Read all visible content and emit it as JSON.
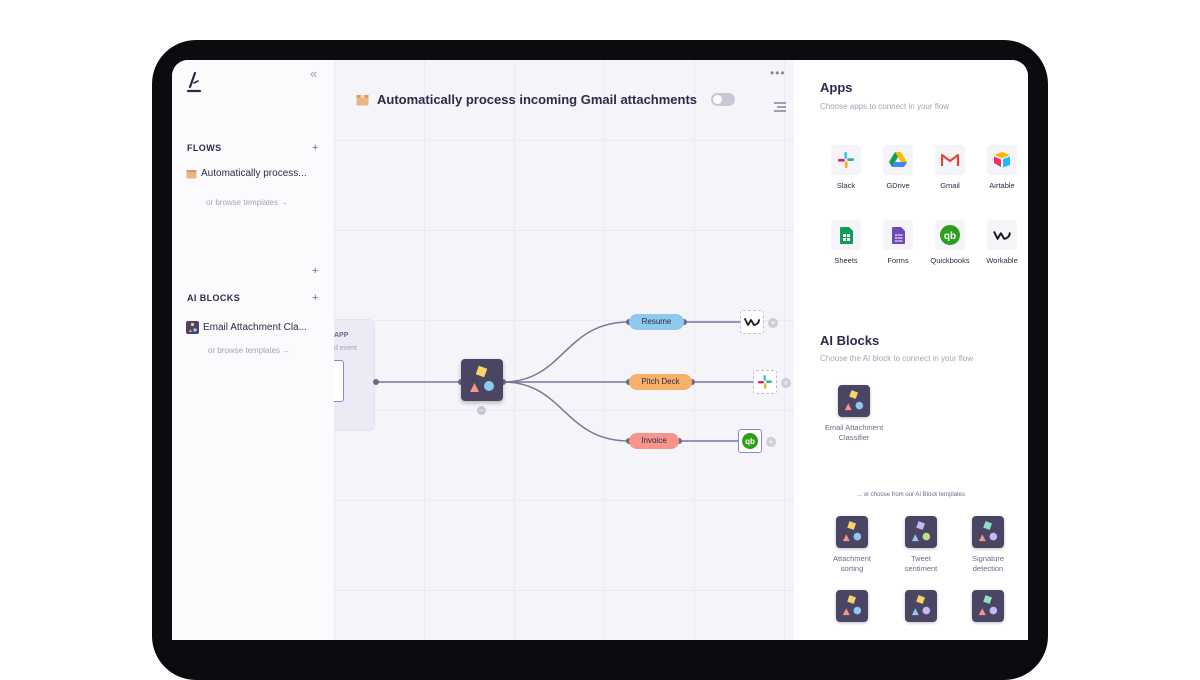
{
  "sidebar": {
    "collapse_glyph": "«",
    "flows_title": "FLOWS",
    "flow_item": "Automatically process...",
    "browse_templates": "or browse templates →",
    "ai_blocks_title": "AI BLOCKS",
    "ai_block_item": "Email Attachment Cla...",
    "ai_browse_templates": "or browse templates →"
  },
  "canvas": {
    "flow_title": "Automatically process incoming Gmail attachments",
    "more_glyph": "•••",
    "ghost_label": "APP",
    "ghost_sub": "d event",
    "branches": [
      {
        "label": "Resume",
        "color": "#8ec9ee"
      },
      {
        "label": "Pitch Deck",
        "color": "#f7b06a"
      },
      {
        "label": "Invoice",
        "color": "#f7958a"
      }
    ]
  },
  "panel": {
    "apps_title": "Apps",
    "apps_sub": "Choose apps to connect in your flow",
    "apps": [
      {
        "label": "Slack",
        "icon": "slack-icon"
      },
      {
        "label": "GDrive",
        "icon": "gdrive-icon"
      },
      {
        "label": "Gmail",
        "icon": "gmail-icon"
      },
      {
        "label": "Airtable",
        "icon": "airtable-icon"
      },
      {
        "label": "Sheets",
        "icon": "sheets-icon"
      },
      {
        "label": "Forms",
        "icon": "forms-icon"
      },
      {
        "label": "Quickbooks",
        "icon": "quickbooks-icon"
      },
      {
        "label": "Workable",
        "icon": "workable-icon"
      }
    ],
    "ai_title": "AI Blocks",
    "ai_sub": "Choose the AI block to connect in your flow",
    "ai_block": {
      "line1": "Email Attachment",
      "line2": "Classifier"
    },
    "templates_note": "... or choose from our AI Block templates",
    "templates": [
      {
        "line1": "Attachment",
        "line2": "sorting"
      },
      {
        "line1": "Tweet",
        "line2": "sentiment"
      },
      {
        "line1": "Signature",
        "line2": "detection"
      }
    ]
  },
  "colors": {
    "accent": "#8b83d6",
    "block_bg": "#4a4563",
    "text": "#2d2a4a"
  }
}
